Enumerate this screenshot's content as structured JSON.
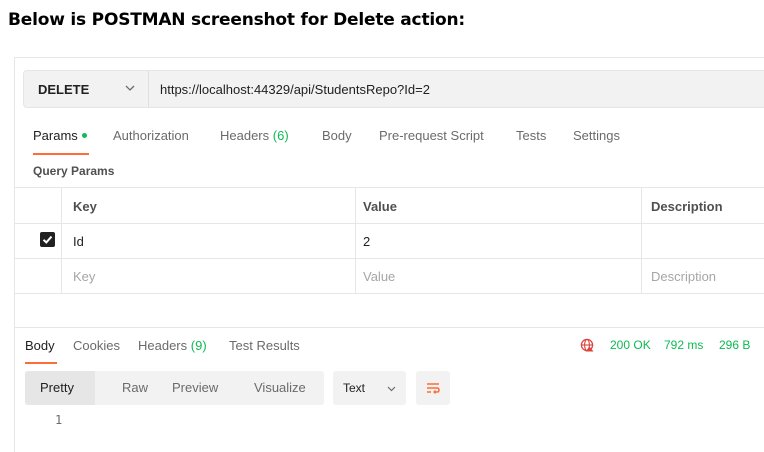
{
  "heading": "Below is POSTMAN screenshot for Delete action:",
  "request": {
    "method": "DELETE",
    "url": "https://localhost:44329/api/StudentsRepo?Id=2",
    "tabs": {
      "params": "Params",
      "authorization": "Authorization",
      "headers": "Headers",
      "headers_count": "(6)",
      "body": "Body",
      "prerequest": "Pre-request Script",
      "tests": "Tests",
      "settings": "Settings"
    },
    "query_params_title": "Query Params",
    "table": {
      "columns": [
        "Key",
        "Value",
        "Description"
      ],
      "rows": [
        {
          "checked": true,
          "key": "Id",
          "value": "2",
          "description": ""
        }
      ],
      "placeholders": {
        "key": "Key",
        "value": "Value",
        "description": "Description"
      }
    }
  },
  "response": {
    "tabs": {
      "body": "Body",
      "cookies": "Cookies",
      "headers": "Headers",
      "headers_count": "(9)",
      "test_results": "Test Results"
    },
    "status": "200 OK",
    "time": "792 ms",
    "size": "296 B",
    "view_modes": [
      "Pretty",
      "Raw",
      "Preview",
      "Visualize"
    ],
    "format": "Text",
    "line_number": "1"
  },
  "colors": {
    "accent": "#ff6c37",
    "success": "#0cbb52"
  }
}
